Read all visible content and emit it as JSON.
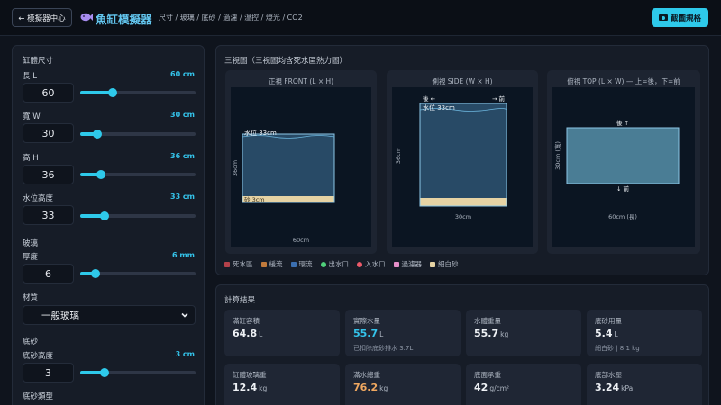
{
  "header": {
    "back_label": "← 模擬器中心",
    "title": "魚缸模擬器",
    "subtitle": "尺寸 / 玻璃 / 底砂 / 過濾 / 溫控 / 燈光 / CO2",
    "screenshot_label": "截圖規格"
  },
  "sidebar": {
    "tank_section": "缸體尺寸",
    "fields": [
      {
        "label": "長 L",
        "value_text": "60 cm",
        "input": "60",
        "fraction": 0.28
      },
      {
        "label": "寬 W",
        "value_text": "30 cm",
        "input": "30",
        "fraction": 0.15
      },
      {
        "label": "高 H",
        "value_text": "36 cm",
        "input": "36",
        "fraction": 0.18
      },
      {
        "label": "水位高度",
        "value_text": "33 cm",
        "input": "33",
        "fraction": 0.21
      }
    ],
    "glass_section": "玻璃",
    "thickness": {
      "label": "厚度",
      "value_text": "6 mm",
      "input": "6",
      "fraction": 0.13
    },
    "material_label": "材質",
    "material_selected": "一般玻璃",
    "substrate_section": "底砂",
    "substrate_height": {
      "label": "底砂高度",
      "value_text": "3 cm",
      "input": "3",
      "fraction": 0.21
    },
    "substrate_type_label": "底砂類型"
  },
  "views": {
    "panel_title": "三視圖（三視圖均含死水區熱力圖）",
    "front": {
      "title": "正視 FRONT (L × H)",
      "water_label": "水位 33cm",
      "sand_label": "砂 3cm",
      "height_label": "36cm",
      "width_label": "60cm"
    },
    "side": {
      "title": "側視 SIDE (W × H)",
      "back_label": "後 ←",
      "front_label": "→ 前",
      "water_label": "水位 33cm",
      "height_label": "36cm",
      "width_label": "30cm"
    },
    "top": {
      "title": "俯視 TOP (L × W) — 上=後，下=前",
      "back_label": "後 ↑",
      "front_label": "↓ 前",
      "depth_label": "30cm (寬)",
      "length_label": "60cm (長)"
    }
  },
  "legend": [
    {
      "label": "死水區",
      "color": "#b3414a",
      "shape": "square"
    },
    {
      "label": "緩流",
      "color": "#c07a3c",
      "shape": "square"
    },
    {
      "label": "環流",
      "color": "#3b6fb0",
      "shape": "square"
    },
    {
      "label": "出水口",
      "color": "#4fd07a",
      "shape": "dot"
    },
    {
      "label": "入水口",
      "color": "#ec5a6a",
      "shape": "dot"
    },
    {
      "label": "過濾器",
      "color": "#e58fc9",
      "shape": "square"
    },
    {
      "label": "細白砂",
      "color": "#e6d3a4",
      "shape": "square"
    }
  ],
  "results": {
    "title": "計算結果",
    "cards": [
      {
        "label": "滿缸容積",
        "value": "64.8",
        "unit": "L",
        "sub": "",
        "color": "#eef1f5"
      },
      {
        "label": "實際水量",
        "value": "55.7",
        "unit": "L",
        "sub": "已扣除底砂排水 3.7L",
        "color": "#34c3ea"
      },
      {
        "label": "水體重量",
        "value": "55.7",
        "unit": "kg",
        "sub": "",
        "color": "#eef1f5"
      },
      {
        "label": "底砂用量",
        "value": "5.4",
        "unit": "L",
        "sub": "細白砂 | 8.1 kg",
        "color": "#eef1f5"
      },
      {
        "label": "缸體玻璃重",
        "value": "12.4",
        "unit": "kg",
        "sub": "",
        "color": "#eef1f5"
      },
      {
        "label": "滿水總重",
        "value": "76.2",
        "unit": "kg",
        "sub": "",
        "color": "#f0a860"
      },
      {
        "label": "底面承重",
        "value": "42",
        "unit": "g/cm²",
        "sub": "",
        "color": "#eef1f5"
      },
      {
        "label": "底部水壓",
        "value": "3.24",
        "unit": "kPa",
        "sub": "",
        "color": "#eef1f5"
      }
    ]
  }
}
